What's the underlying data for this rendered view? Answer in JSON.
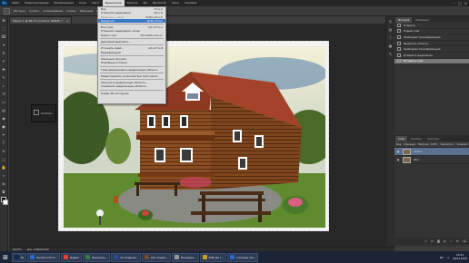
{
  "menubar": {
    "logo": "Ps",
    "items": [
      "Файл",
      "Редактирование",
      "Изображение",
      "Слои",
      "Текст",
      "Выделение",
      "Фильтр",
      "3D",
      "Просмотр",
      "Окно",
      "Справка"
    ],
    "active_index": 5
  },
  "options": {
    "labels": [
      "Растуш.:",
      "0 пикс.",
      "Сглаживание",
      "Стиль:",
      "Обычный",
      "Ширина:",
      "Высота:"
    ],
    "refine_button": "Уточн. край..."
  },
  "document": {
    "tab_title": "Макет 1 @ 66,7% (Слой 0, RGB/8) *"
  },
  "select_menu": {
    "items": [
      {
        "label": "Все",
        "shortcut": "Ctrl+A",
        "state": "normal"
      },
      {
        "label": "Отменить выделение",
        "shortcut": "Ctrl+D",
        "state": "normal"
      },
      {
        "label": "Выделить снова",
        "shortcut": "Shift+Ctrl+D",
        "state": "disabled"
      },
      {
        "label": "Инверсия",
        "shortcut": "Shift+Ctrl+I",
        "state": "highlight"
      },
      {
        "sep": true
      },
      {
        "label": "Все слои",
        "shortcut": "Alt+Ctrl+A",
        "state": "normal"
      },
      {
        "label": "Отменить выделение слоев",
        "shortcut": "",
        "state": "normal"
      },
      {
        "label": "Найти слои",
        "shortcut": "Alt+Shift+Ctrl+F",
        "state": "normal"
      },
      {
        "sep": true
      },
      {
        "label": "Цветовой диапазон...",
        "shortcut": "",
        "state": "normal"
      },
      {
        "sep": true
      },
      {
        "label": "Уточнить край...",
        "shortcut": "Alt+Ctrl+R",
        "state": "normal"
      },
      {
        "label": "Модификация",
        "shortcut": "",
        "state": "normal"
      },
      {
        "sep": true
      },
      {
        "label": "Смежные пиксели",
        "shortcut": "",
        "state": "normal"
      },
      {
        "label": "Подобные оттенки",
        "shortcut": "",
        "state": "normal"
      },
      {
        "sep": true
      },
      {
        "label": "Трансформировать выделенную область",
        "shortcut": "",
        "state": "normal"
      },
      {
        "sep": true
      },
      {
        "label": "Редактировать в режиме быстрой маски",
        "shortcut": "",
        "state": "normal"
      },
      {
        "sep": true
      },
      {
        "label": "Загрузить выделенную область...",
        "shortcut": "",
        "state": "normal"
      },
      {
        "label": "Сохранить выделенную область...",
        "shortcut": "",
        "state": "normal"
      },
      {
        "sep": true
      },
      {
        "label": "Новая 3D-экструзия",
        "shortcut": "",
        "state": "normal"
      }
    ]
  },
  "minipanel": {
    "label": "Слой без..."
  },
  "right_panel": {
    "history_tabs": [
      "История",
      "Операции"
    ],
    "history_items": [
      "Открыть",
      "Новый слой",
      "Свободная трансформация",
      "Выделить область",
      "Свободная трансформация",
      "Отменить выделение",
      "Вставить слой"
    ],
    "history_selected": 6,
    "layer_tabs": [
      "Слои",
      "Каналы",
      "Контуры"
    ],
    "layer_options": [
      "Вид",
      "Обычные",
      "Непрозр.: 100%",
      "Закрепить:",
      "Заливка: 100%"
    ],
    "layers": [
      {
        "name": "Слой 1",
        "selected": true
      },
      {
        "name": "Фон",
        "selected": false
      }
    ],
    "footer_icons": [
      "link-icon",
      "fx-icon",
      "mask-icon",
      "adjust-icon",
      "folder-icon",
      "new-layer-icon",
      "trash-icon"
    ]
  },
  "status": {
    "zoom": "66,67%",
    "doc": "Док: 2,86M/10,4M"
  },
  "taskbar": {
    "items": [
      {
        "label": "Ps",
        "color": "#0f2a48"
      },
      {
        "label": "Рисуем в Фото...",
        "color": "#2a6ad0"
      },
      {
        "label": "Яндекс",
        "color": "#e04030"
      },
      {
        "label": "Безымянн...",
        "color": "#3a7a3a"
      },
      {
        "label": "на создание...",
        "color": "#2a4a9a"
      },
      {
        "label": "Как соедин...",
        "color": "#7a4a20"
      },
      {
        "label": "Безымянн...",
        "color": "#999999"
      },
      {
        "label": "Рабочая т...",
        "color": "#d0a020"
      },
      {
        "label": "Сложные тек...",
        "color": "#2a6ad0"
      }
    ],
    "lang": "RU",
    "time": "15:31",
    "date": "26.02.2015"
  }
}
